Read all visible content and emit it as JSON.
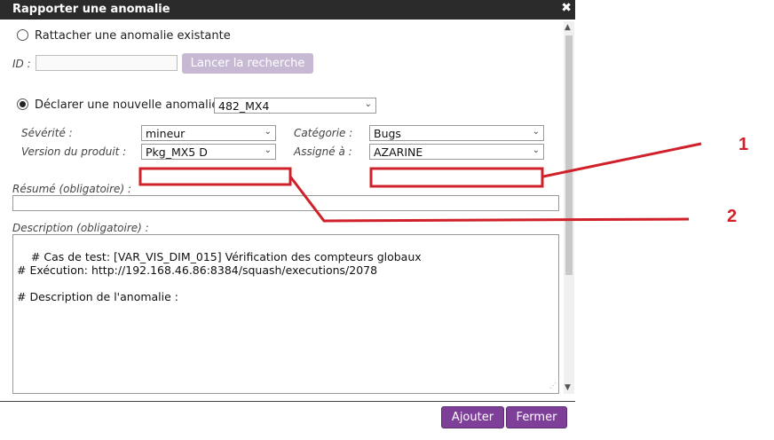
{
  "dialog": {
    "title": "Rapporter une anomalie",
    "close": "✖"
  },
  "attach": {
    "label": "Rattacher une anomalie existante",
    "id_label": "ID :",
    "id_value": "",
    "search_button": "Lancer la recherche"
  },
  "declare": {
    "label": "Déclarer une nouvelle anomalie",
    "project_value": "482_MX4"
  },
  "fields": {
    "severity_label": "Sévérité :",
    "severity_value": "mineur",
    "category_label": "Catégorie :",
    "category_value": "Bugs",
    "version_label": "Version du produit :",
    "version_value": "Pkg_MX5 D",
    "assigned_label": "Assigné à :",
    "assigned_value": "AZARINE",
    "summary_label": "Résumé (obligatoire) :",
    "summary_value": "",
    "description_label": "Description (obligatoire) :",
    "description_value": "# Cas de test: [VAR_VIS_DIM_015] Vérification des compteurs globaux\n# Exécution: http://192.168.46.86:8384/squash/executions/2078\n\n# Description de l'anomalie :"
  },
  "footer": {
    "add_button": "Ajouter",
    "close_button": "Fermer"
  },
  "annotations": {
    "marker_1": "1",
    "marker_2": "2",
    "color": "#d0202a"
  }
}
